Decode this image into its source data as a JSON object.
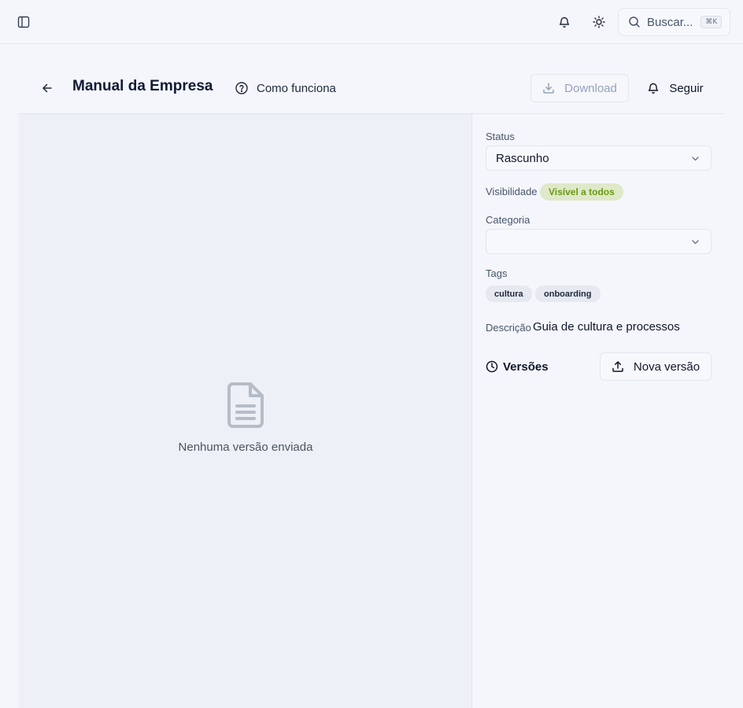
{
  "topbar": {
    "icons": [
      "sidebar-toggle-icon",
      "bell-icon",
      "sun-icon",
      "search-icon"
    ],
    "search": {
      "label": "Buscar...",
      "shortcut": "⌘K"
    }
  },
  "header": {
    "title": "Manual da Empresa",
    "help_label": "Como funciona",
    "download_label": "Download",
    "follow_label": "Seguir"
  },
  "preview": {
    "empty_text": "Nenhuma versão enviada"
  },
  "details": {
    "status": {
      "label": "Status",
      "value": "Rascunho"
    },
    "visibility": {
      "label": "Visibilidade",
      "value": "Visível a todos"
    },
    "category": {
      "label": "Categoria",
      "value": ""
    },
    "tags": {
      "label": "Tags",
      "items": [
        "cultura",
        "onboarding"
      ]
    },
    "description": {
      "label": "Descrição",
      "value": "Guia de cultura e processos"
    }
  },
  "versions": {
    "title": "Versões",
    "new_label": "Nova versão"
  },
  "colors": {
    "background": "#f4f6fb",
    "badge_bg": "#dfe9c9",
    "badge_text": "#6a9a13"
  }
}
